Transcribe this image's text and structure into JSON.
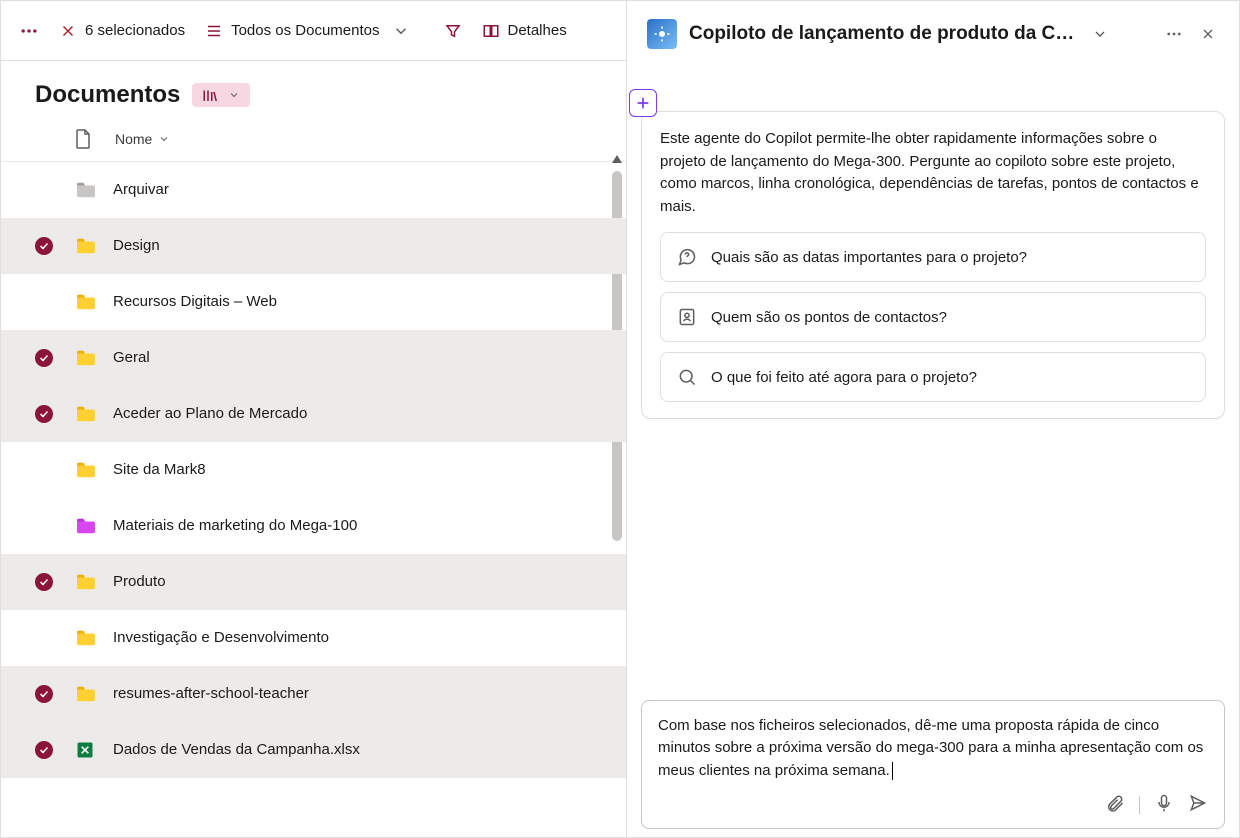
{
  "toolbar": {
    "selected_count": "6 selecionados",
    "view_label": "Todos os Documentos",
    "details_label": "Detalhes"
  },
  "library": {
    "title": "Documentos"
  },
  "columns": {
    "name": "Nome"
  },
  "rows": [
    {
      "name": "Arquivar",
      "icon": "folder-gray",
      "selected": false
    },
    {
      "name": "Design",
      "icon": "folder-yellow",
      "selected": true
    },
    {
      "name": "Recursos Digitais – Web",
      "icon": "folder-yellow",
      "selected": false
    },
    {
      "name": "Geral",
      "icon": "folder-yellow",
      "selected": true
    },
    {
      "name": "Aceder ao Plano de Mercado",
      "icon": "folder-yellow",
      "selected": true
    },
    {
      "name": "Site da Mark8",
      "icon": "folder-yellow",
      "selected": false
    },
    {
      "name": "Materiais de marketing do Mega-100",
      "icon": "folder-purple",
      "selected": false
    },
    {
      "name": "Produto",
      "icon": "folder-yellow",
      "selected": true
    },
    {
      "name": "Investigação e Desenvolvimento",
      "icon": "folder-yellow",
      "selected": false
    },
    {
      "name": "resumes-after-school-teacher",
      "icon": "folder-yellow",
      "selected": true
    },
    {
      "name": "Dados de Vendas da Campanha.xlsx",
      "icon": "file-excel",
      "selected": true
    }
  ],
  "copilot": {
    "title": "Copiloto de lançamento de produto da C…",
    "intro": "Este agente do Copilot permite-lhe obter rapidamente informações sobre o projeto de lançamento do Mega-300. Pergunte ao copiloto sobre este projeto, como marcos, linha cronológica, dependências de tarefas, pontos de contactos e mais.",
    "suggestions": [
      "Quais são as datas importantes para o projeto?",
      "Quem são os pontos de contactos?",
      "O que foi feito até agora para o projeto?"
    ],
    "compose": "Com base nos ficheiros selecionados, dê-me uma proposta rápida de cinco minutos sobre a próxima versão do mega-300 para a minha apresentação com os meus clientes na próxima semana."
  }
}
